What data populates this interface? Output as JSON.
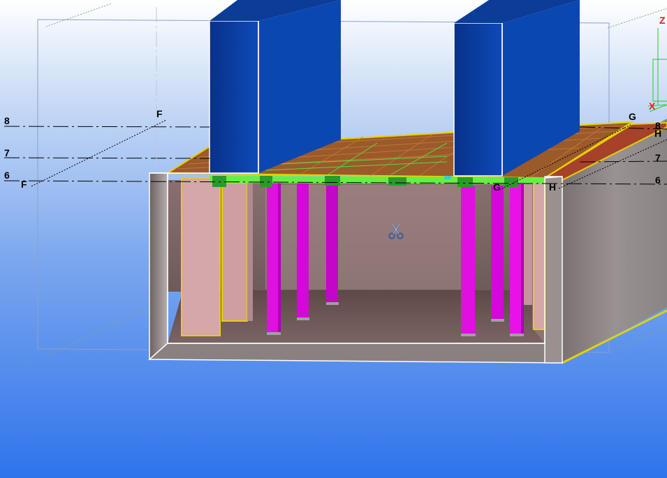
{
  "gridlines": {
    "level_8": "8",
    "level_7": "7",
    "level_6": "6",
    "axis_f": "F",
    "axis_g": "G",
    "axis_h": "H"
  },
  "axes": {
    "z": "Z",
    "x": "X"
  },
  "colors": {
    "background_top": "#ffffff",
    "background_bottom": "#2f74ec",
    "wall_blue": "#0a3a9e",
    "column_magenta": "#e010e0",
    "slab_green": "#66ee44",
    "deck_brown": "#9a5a2a",
    "outline_yellow": "#e8d000",
    "tank_wall": "#9a8e8e",
    "tank_floor": "#6e5858"
  },
  "icons": {
    "cursor": "scissors-icon"
  }
}
